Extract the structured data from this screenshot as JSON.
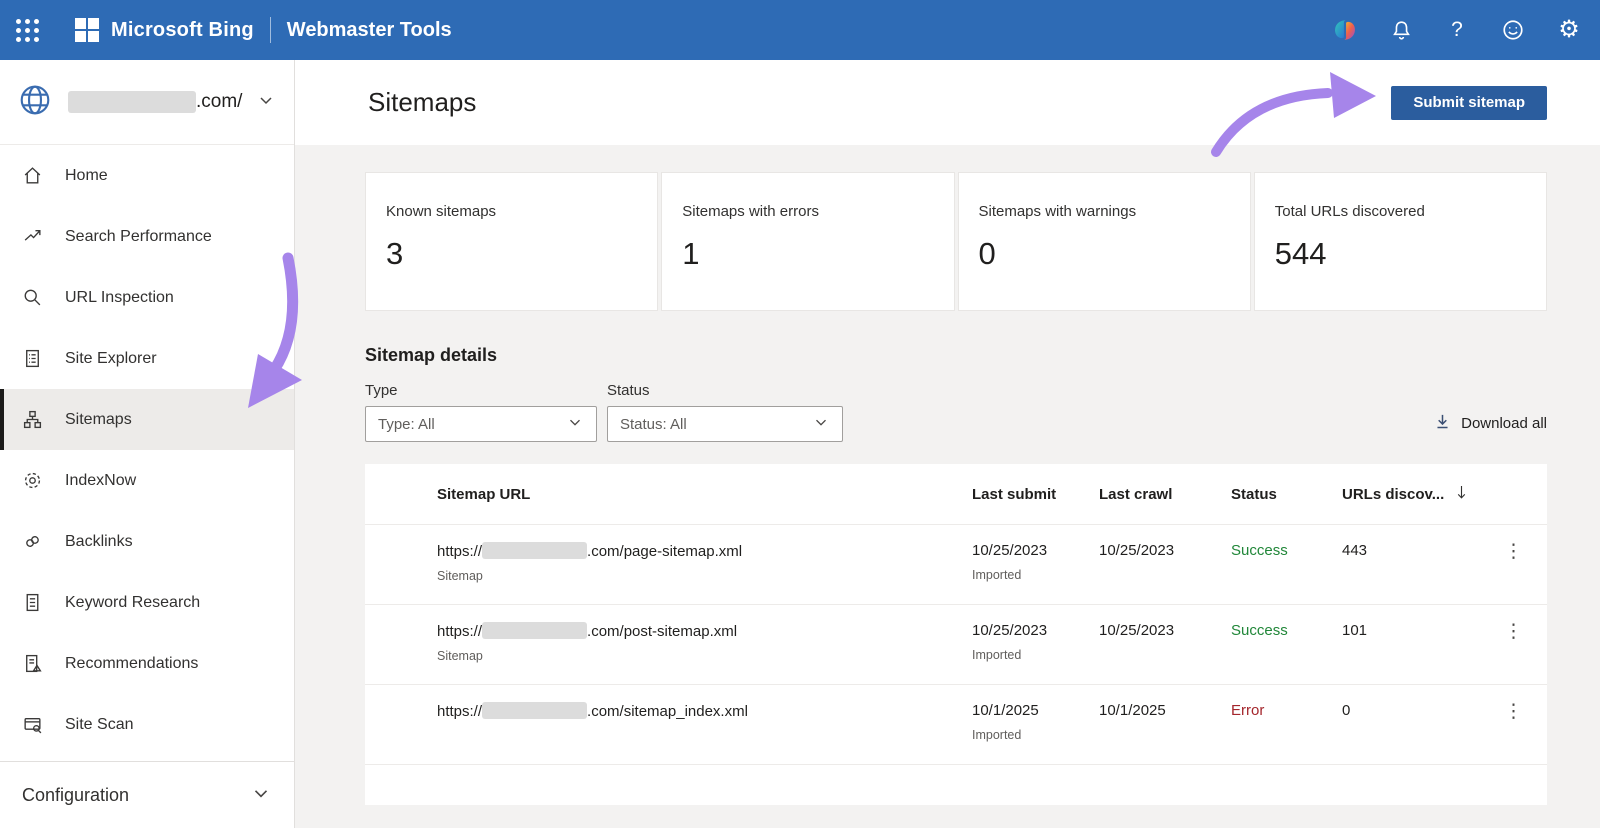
{
  "colors": {
    "topbar": "#2e6bb5",
    "primary_button": "#2b5d9e",
    "success": "#218739",
    "error": "#a4262c",
    "arrow": "#a685ea",
    "selected_nav_bg": "#edebe9"
  },
  "icons": {
    "help": "?",
    "gear": "⚙",
    "more": "⋮"
  },
  "header": {
    "brand": "Microsoft Bing",
    "product": "Webmaster Tools"
  },
  "sidebar": {
    "site": {
      "domain_suffix": ".com/"
    },
    "items": [
      {
        "label": "Home"
      },
      {
        "label": "Search Performance"
      },
      {
        "label": "URL Inspection"
      },
      {
        "label": "Site Explorer"
      },
      {
        "label": "Sitemaps"
      },
      {
        "label": "IndexNow"
      },
      {
        "label": "Backlinks"
      },
      {
        "label": "Keyword Research"
      },
      {
        "label": "Recommendations"
      },
      {
        "label": "Site Scan"
      }
    ],
    "footer": {
      "label": "Configuration"
    }
  },
  "page": {
    "title": "Sitemaps",
    "submit_button": "Submit sitemap"
  },
  "stats": [
    {
      "label": "Known sitemaps",
      "value": "3"
    },
    {
      "label": "Sitemaps with errors",
      "value": "1"
    },
    {
      "label": "Sitemaps with warnings",
      "value": "0"
    },
    {
      "label": "Total URLs discovered",
      "value": "544"
    }
  ],
  "details": {
    "heading": "Sitemap details",
    "filters": [
      {
        "label": "Type",
        "value": "Type: All"
      },
      {
        "label": "Status",
        "value": "Status: All"
      }
    ],
    "download_all": "Download all"
  },
  "table": {
    "columns": {
      "url": "Sitemap URL",
      "last_submit": "Last submit",
      "last_crawl": "Last crawl",
      "status": "Status",
      "urls": "URLs discov..."
    },
    "rows": [
      {
        "url_prefix": "https://",
        "url_suffix": ".com/page-sitemap.xml",
        "type": "Sitemap",
        "last_submit": "10/25/2023",
        "submit_note": "Imported",
        "last_crawl": "10/25/2023",
        "status": "Success",
        "status_color": "#218739",
        "urls": "443"
      },
      {
        "url_prefix": "https://",
        "url_suffix": ".com/post-sitemap.xml",
        "type": "Sitemap",
        "last_submit": "10/25/2023",
        "submit_note": "Imported",
        "last_crawl": "10/25/2023",
        "status": "Success",
        "status_color": "#218739",
        "urls": "101"
      },
      {
        "url_prefix": "https://",
        "url_suffix": ".com/sitemap_index.xml",
        "type": "",
        "last_submit": "10/1/2025",
        "submit_note": "Imported",
        "last_crawl": "10/1/2025",
        "status": "Error",
        "status_color": "#a4262c",
        "urls": "0"
      }
    ]
  }
}
